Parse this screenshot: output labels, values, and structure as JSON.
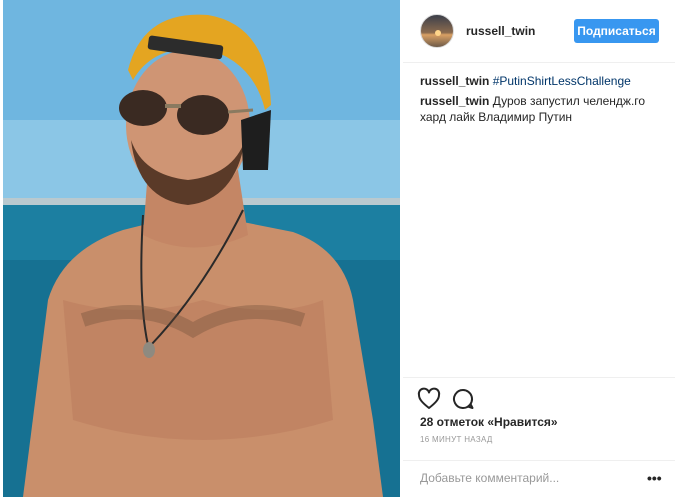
{
  "post": {
    "username": "russell_twin",
    "follow_label": "Подписаться",
    "comments": [
      {
        "user": "russell_twin",
        "hashtag": "#PutinShirtLessChallenge",
        "text": ""
      },
      {
        "user": "russell_twin",
        "hashtag": "",
        "text": "Дуров запустил челендж.го хард лайк Владимир Путин"
      }
    ],
    "likes": "28 отметок «Нравится»",
    "time": "16 минут назад",
    "comment_placeholder": "Добавьте комментарий...",
    "more": "•••"
  },
  "icons": {
    "like": "heart-icon",
    "comment": "comment-icon",
    "more": "more-options-icon"
  },
  "colors": {
    "follow_button": "#3897f0",
    "hashtag": "#003569",
    "text": "#262626",
    "muted": "#999999"
  }
}
